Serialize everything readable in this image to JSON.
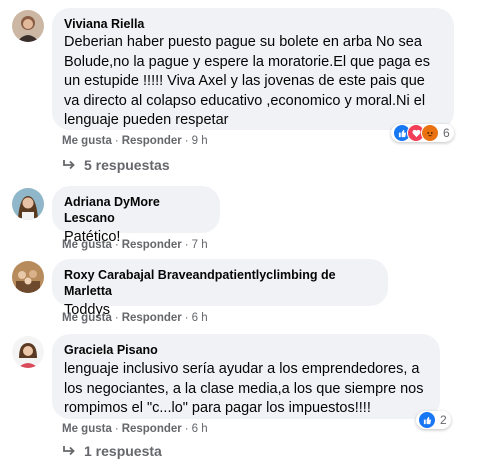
{
  "actions": {
    "like": "Me gusta",
    "reply": "Responder",
    "separator": "·"
  },
  "colors": {
    "like_blue": "#1877f2",
    "love_red": "#f33e58",
    "angry_orange": "#e9710f"
  },
  "comments": [
    {
      "author": "Viviana Riella",
      "text": "Deberian haber puesto pague su bolete en arba No sea Bolude,no la pague y espere la moratorie.El que paga es un estupide !!!!! Viva Axel y las jovenas de este pais que va directo al colapso educativo ,economico y moral.Ni el lenguaje pueden respetar",
      "time": "9 h",
      "reactions": {
        "icons": [
          "like-icon",
          "love-icon",
          "angry-icon"
        ],
        "count": "6"
      },
      "replies_label": "5 respuestas"
    },
    {
      "author": "Adriana DyMore Lescano",
      "text": "Patético!",
      "time": "7 h"
    },
    {
      "author": "Roxy Carabajal Braveandpatientlyclimbing de Marletta",
      "text": "Toddys",
      "time": "6 h"
    },
    {
      "author": "Graciela Pisano",
      "text": "lenguaje inclusivo sería ayudar a los emprendedores, a los negociantes, a la clase media,a los que siempre nos rompimos el \"c...lo\" para pagar los impuestos!!!!",
      "time": "6 h",
      "reactions": {
        "icons": [
          "like-icon"
        ],
        "count": "2"
      },
      "replies_label": "1 respuesta"
    }
  ]
}
